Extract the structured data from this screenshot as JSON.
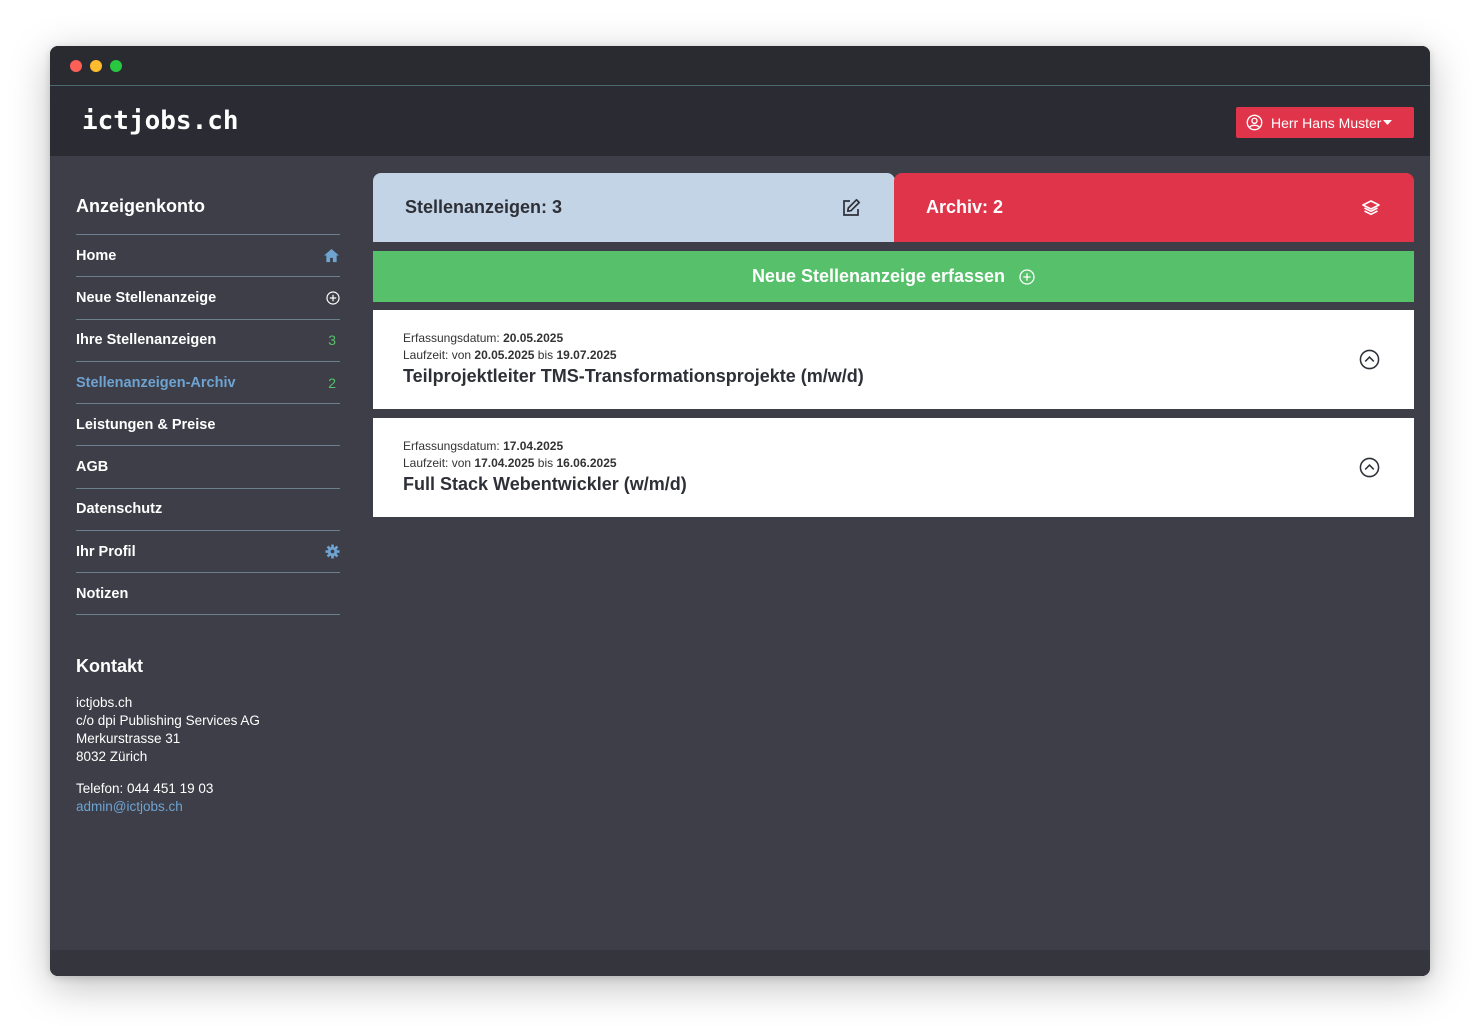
{
  "header": {
    "logo": "ictjobs.ch",
    "user_label": "Herr Hans Muster"
  },
  "sidebar": {
    "title": "Anzeigenkonto",
    "items": [
      {
        "label": "Home",
        "icon": "home-icon"
      },
      {
        "label": "Neue Stellenanzeige",
        "icon": "plus-circle-icon"
      },
      {
        "label": "Ihre Stellenanzeigen",
        "count": "3"
      },
      {
        "label": "Stellenanzeigen-Archiv",
        "count": "2"
      },
      {
        "label": "Leistungen & Preise"
      },
      {
        "label": "AGB"
      },
      {
        "label": "Datenschutz"
      },
      {
        "label": "Ihr Profil",
        "icon": "gear-icon"
      },
      {
        "label": "Notizen"
      }
    ]
  },
  "kontakt": {
    "title": "Kontakt",
    "line1": "ictjobs.ch",
    "line2": "c/o dpi Publishing Services AG",
    "line3": "Merkurstrasse 31",
    "line4": "8032 Zürich",
    "phone": "Telefon: 044 451 19 03",
    "email": "admin@ictjobs.ch"
  },
  "tabs": {
    "active_label": "Stellenanzeigen: 3",
    "archive_label": "Archiv: 2"
  },
  "new_button_label": "Neue Stellenanzeige erfassen",
  "jobs": [
    {
      "created_label": "Erfassungsdatum:",
      "created": "20.05.2025",
      "runtime_label": "Laufzeit: von",
      "from": "20.05.2025",
      "to_label": "bis",
      "to": "19.07.2025",
      "title": "Teilprojektleiter TMS-Transformationsprojekte (m/w/d)"
    },
    {
      "created_label": "Erfassungsdatum:",
      "created": "17.04.2025",
      "runtime_label": "Laufzeit: von",
      "from": "17.04.2025",
      "to_label": "bis",
      "to": "16.06.2025",
      "title": "Full Stack Webentwickler (w/m/d)"
    }
  ],
  "colors": {
    "accent_red": "#e0344a",
    "accent_green": "#56c06a",
    "link_blue": "#6ea3d2",
    "tab_blue": "#c3d4e6"
  }
}
